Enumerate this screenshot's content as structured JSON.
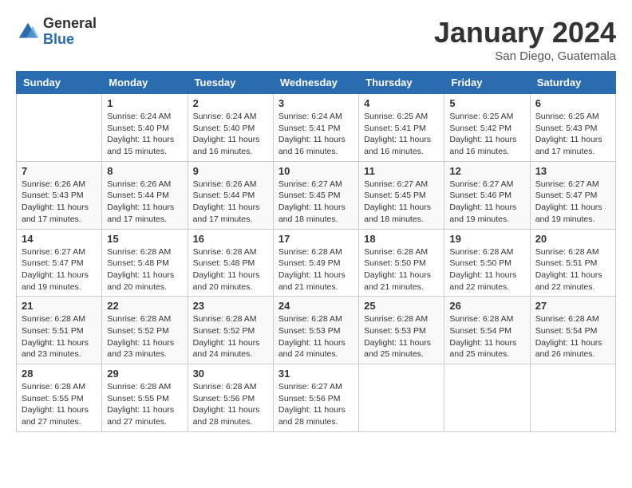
{
  "logo": {
    "general": "General",
    "blue": "Blue"
  },
  "title": "January 2024",
  "location": "San Diego, Guatemala",
  "days_of_week": [
    "Sunday",
    "Monday",
    "Tuesday",
    "Wednesday",
    "Thursday",
    "Friday",
    "Saturday"
  ],
  "weeks": [
    [
      {
        "day": "",
        "info": ""
      },
      {
        "day": "1",
        "info": "Sunrise: 6:24 AM\nSunset: 5:40 PM\nDaylight: 11 hours\nand 15 minutes."
      },
      {
        "day": "2",
        "info": "Sunrise: 6:24 AM\nSunset: 5:40 PM\nDaylight: 11 hours\nand 16 minutes."
      },
      {
        "day": "3",
        "info": "Sunrise: 6:24 AM\nSunset: 5:41 PM\nDaylight: 11 hours\nand 16 minutes."
      },
      {
        "day": "4",
        "info": "Sunrise: 6:25 AM\nSunset: 5:41 PM\nDaylight: 11 hours\nand 16 minutes."
      },
      {
        "day": "5",
        "info": "Sunrise: 6:25 AM\nSunset: 5:42 PM\nDaylight: 11 hours\nand 16 minutes."
      },
      {
        "day": "6",
        "info": "Sunrise: 6:25 AM\nSunset: 5:43 PM\nDaylight: 11 hours\nand 17 minutes."
      }
    ],
    [
      {
        "day": "7",
        "info": "Sunrise: 6:26 AM\nSunset: 5:43 PM\nDaylight: 11 hours\nand 17 minutes."
      },
      {
        "day": "8",
        "info": "Sunrise: 6:26 AM\nSunset: 5:44 PM\nDaylight: 11 hours\nand 17 minutes."
      },
      {
        "day": "9",
        "info": "Sunrise: 6:26 AM\nSunset: 5:44 PM\nDaylight: 11 hours\nand 17 minutes."
      },
      {
        "day": "10",
        "info": "Sunrise: 6:27 AM\nSunset: 5:45 PM\nDaylight: 11 hours\nand 18 minutes."
      },
      {
        "day": "11",
        "info": "Sunrise: 6:27 AM\nSunset: 5:45 PM\nDaylight: 11 hours\nand 18 minutes."
      },
      {
        "day": "12",
        "info": "Sunrise: 6:27 AM\nSunset: 5:46 PM\nDaylight: 11 hours\nand 19 minutes."
      },
      {
        "day": "13",
        "info": "Sunrise: 6:27 AM\nSunset: 5:47 PM\nDaylight: 11 hours\nand 19 minutes."
      }
    ],
    [
      {
        "day": "14",
        "info": "Sunrise: 6:27 AM\nSunset: 5:47 PM\nDaylight: 11 hours\nand 19 minutes."
      },
      {
        "day": "15",
        "info": "Sunrise: 6:28 AM\nSunset: 5:48 PM\nDaylight: 11 hours\nand 20 minutes."
      },
      {
        "day": "16",
        "info": "Sunrise: 6:28 AM\nSunset: 5:48 PM\nDaylight: 11 hours\nand 20 minutes."
      },
      {
        "day": "17",
        "info": "Sunrise: 6:28 AM\nSunset: 5:49 PM\nDaylight: 11 hours\nand 21 minutes."
      },
      {
        "day": "18",
        "info": "Sunrise: 6:28 AM\nSunset: 5:50 PM\nDaylight: 11 hours\nand 21 minutes."
      },
      {
        "day": "19",
        "info": "Sunrise: 6:28 AM\nSunset: 5:50 PM\nDaylight: 11 hours\nand 22 minutes."
      },
      {
        "day": "20",
        "info": "Sunrise: 6:28 AM\nSunset: 5:51 PM\nDaylight: 11 hours\nand 22 minutes."
      }
    ],
    [
      {
        "day": "21",
        "info": "Sunrise: 6:28 AM\nSunset: 5:51 PM\nDaylight: 11 hours\nand 23 minutes."
      },
      {
        "day": "22",
        "info": "Sunrise: 6:28 AM\nSunset: 5:52 PM\nDaylight: 11 hours\nand 23 minutes."
      },
      {
        "day": "23",
        "info": "Sunrise: 6:28 AM\nSunset: 5:52 PM\nDaylight: 11 hours\nand 24 minutes."
      },
      {
        "day": "24",
        "info": "Sunrise: 6:28 AM\nSunset: 5:53 PM\nDaylight: 11 hours\nand 24 minutes."
      },
      {
        "day": "25",
        "info": "Sunrise: 6:28 AM\nSunset: 5:53 PM\nDaylight: 11 hours\nand 25 minutes."
      },
      {
        "day": "26",
        "info": "Sunrise: 6:28 AM\nSunset: 5:54 PM\nDaylight: 11 hours\nand 25 minutes."
      },
      {
        "day": "27",
        "info": "Sunrise: 6:28 AM\nSunset: 5:54 PM\nDaylight: 11 hours\nand 26 minutes."
      }
    ],
    [
      {
        "day": "28",
        "info": "Sunrise: 6:28 AM\nSunset: 5:55 PM\nDaylight: 11 hours\nand 27 minutes."
      },
      {
        "day": "29",
        "info": "Sunrise: 6:28 AM\nSunset: 5:55 PM\nDaylight: 11 hours\nand 27 minutes."
      },
      {
        "day": "30",
        "info": "Sunrise: 6:28 AM\nSunset: 5:56 PM\nDaylight: 11 hours\nand 28 minutes."
      },
      {
        "day": "31",
        "info": "Sunrise: 6:27 AM\nSunset: 5:56 PM\nDaylight: 11 hours\nand 28 minutes."
      },
      {
        "day": "",
        "info": ""
      },
      {
        "day": "",
        "info": ""
      },
      {
        "day": "",
        "info": ""
      }
    ]
  ]
}
